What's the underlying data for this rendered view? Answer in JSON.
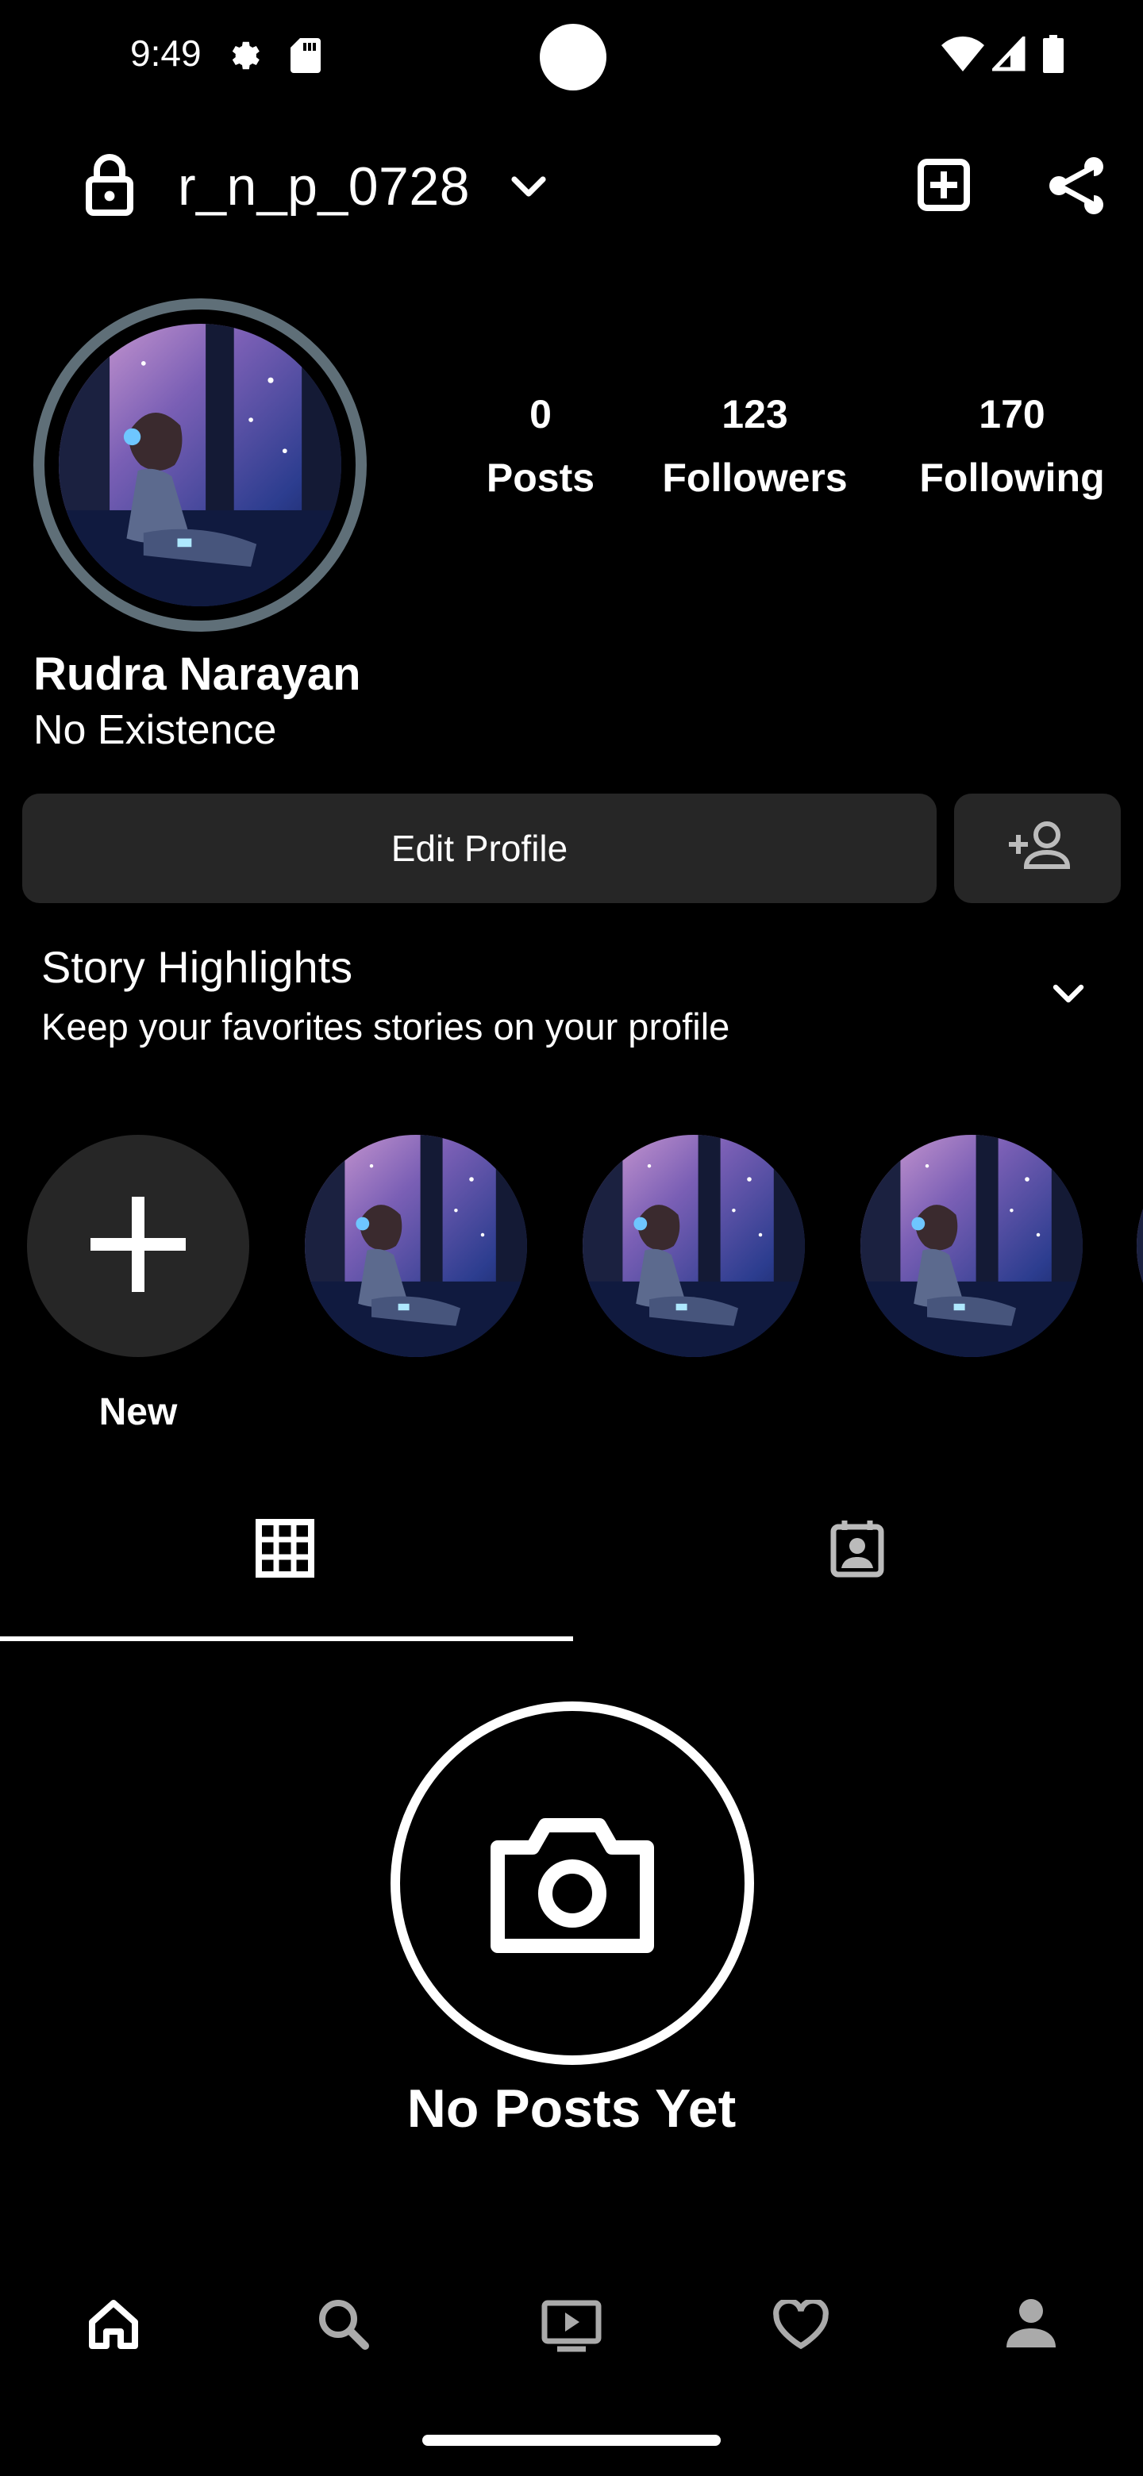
{
  "status_bar": {
    "time": "9:49",
    "icons": [
      "settings-gear-icon",
      "sd-card-icon",
      "wifi-icon",
      "signal-icon",
      "battery-icon"
    ]
  },
  "header": {
    "username": "r_n_p_0728",
    "icons": [
      "lock-icon",
      "chevron-down-icon",
      "add-post-icon",
      "share-icon"
    ]
  },
  "profile": {
    "stats": [
      {
        "value": "0",
        "label": "Posts"
      },
      {
        "value": "123",
        "label": "Followers"
      },
      {
        "value": "170",
        "label": "Following"
      }
    ],
    "display_name": "Rudra Narayan",
    "bio": "No Existence"
  },
  "actions": {
    "edit_profile": "Edit Profile",
    "add_person_icon": "add-person-icon"
  },
  "highlights": {
    "title": "Story Highlights",
    "subtitle": "Keep your favorites stories on your profile",
    "new_label": "New"
  },
  "tabs": {
    "items": [
      "grid-icon",
      "tagged-icon"
    ],
    "active": 0
  },
  "empty_state": {
    "text": "No Posts Yet",
    "icon": "camera-icon"
  },
  "bottom_nav": {
    "items": [
      "home-icon",
      "search-icon",
      "reels-icon",
      "heart-icon",
      "profile-icon"
    ]
  },
  "colors": {
    "background": "#000000",
    "button": "#262626",
    "avatar_ring": "#5f6f78"
  }
}
